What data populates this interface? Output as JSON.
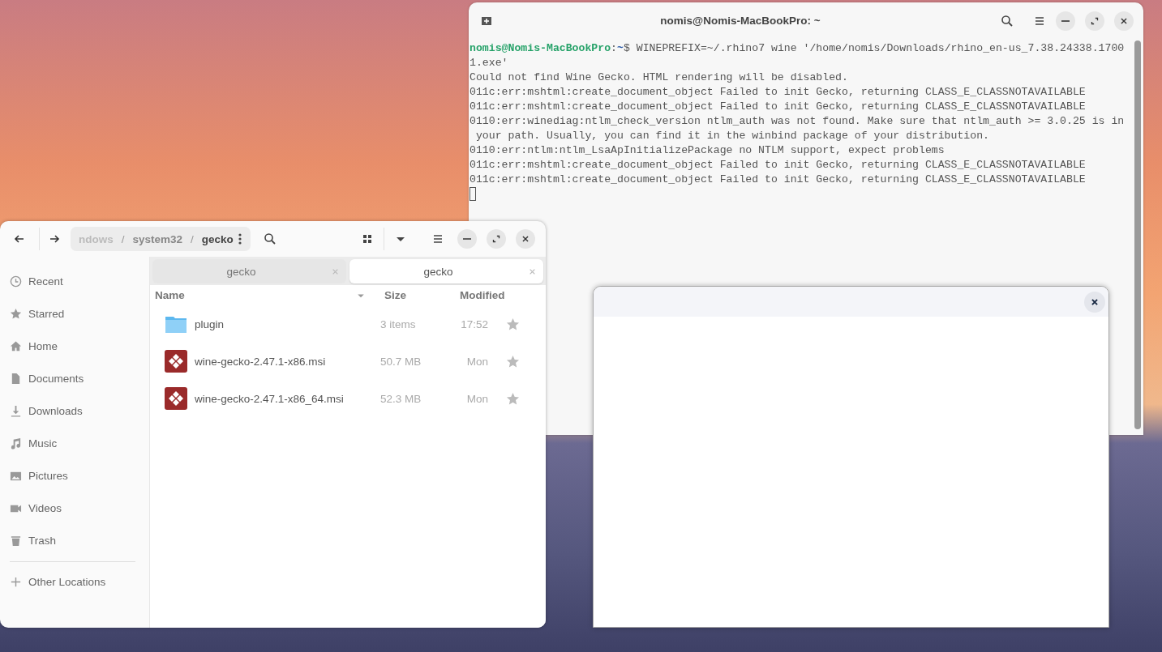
{
  "terminal": {
    "title": "nomis@Nomis-MacBookPro: ~",
    "prompt": {
      "user": "nomis@Nomis-MacBookPro",
      "separator": ":",
      "path": "~",
      "command": "$ WINEPREFIX=~/.rhino7 wine '/home/nomis/Downloads/rhino_en-us_7.38.24338.1700"
    },
    "output": [
      "1.exe'",
      "Could not find Wine Gecko. HTML rendering will be disabled.",
      "011c:err:mshtml:create_document_object Failed to init Gecko, returning CLASS_E_CLASSNOTAVAILABLE",
      "011c:err:mshtml:create_document_object Failed to init Gecko, returning CLASS_E_CLASSNOTAVAILABLE",
      "0110:err:winediag:ntlm_check_version ntlm_auth was not found. Make sure that ntlm_auth >= 3.0.25 is in",
      " your path. Usually, you can find it in the winbind package of your distribution.",
      "0110:err:ntlm:ntlm_LsaApInitializePackage no NTLM support, expect problems",
      "011c:err:mshtml:create_document_object Failed to init Gecko, returning CLASS_E_CLASSNOTAVAILABLE",
      "011c:err:mshtml:create_document_object Failed to init Gecko, returning CLASS_E_CLASSNOTAVAILABLE"
    ]
  },
  "files": {
    "breadcrumb": [
      {
        "label": "ndows",
        "current": false
      },
      {
        "label": "system32",
        "current": false
      },
      {
        "label": "gecko",
        "current": true
      }
    ],
    "breadcrumb_separator": "/",
    "sidebar": {
      "items": [
        {
          "label": "Recent"
        },
        {
          "label": "Starred"
        },
        {
          "label": "Home"
        },
        {
          "label": "Documents"
        },
        {
          "label": "Downloads"
        },
        {
          "label": "Music"
        },
        {
          "label": "Pictures"
        },
        {
          "label": "Videos"
        },
        {
          "label": "Trash"
        }
      ],
      "other_locations": "Other Locations"
    },
    "tabs": [
      {
        "label": "gecko",
        "selected": false
      },
      {
        "label": "gecko",
        "selected": true
      }
    ],
    "columns": [
      "Name",
      "Size",
      "Modified"
    ],
    "rows": [
      {
        "kind": "folder",
        "name": "plugin",
        "size": "3 items",
        "modified": "17:52",
        "starred": false
      },
      {
        "kind": "installer",
        "name": "wine-gecko-2.47.1-x86.msi",
        "size": "50.7 MB",
        "modified": "Mon",
        "starred": false
      },
      {
        "kind": "installer",
        "name": "wine-gecko-2.47.1-x86_64.msi",
        "size": "52.3 MB",
        "modified": "Mon",
        "starred": false
      }
    ]
  },
  "dialog": {
    "has_close": true
  }
}
